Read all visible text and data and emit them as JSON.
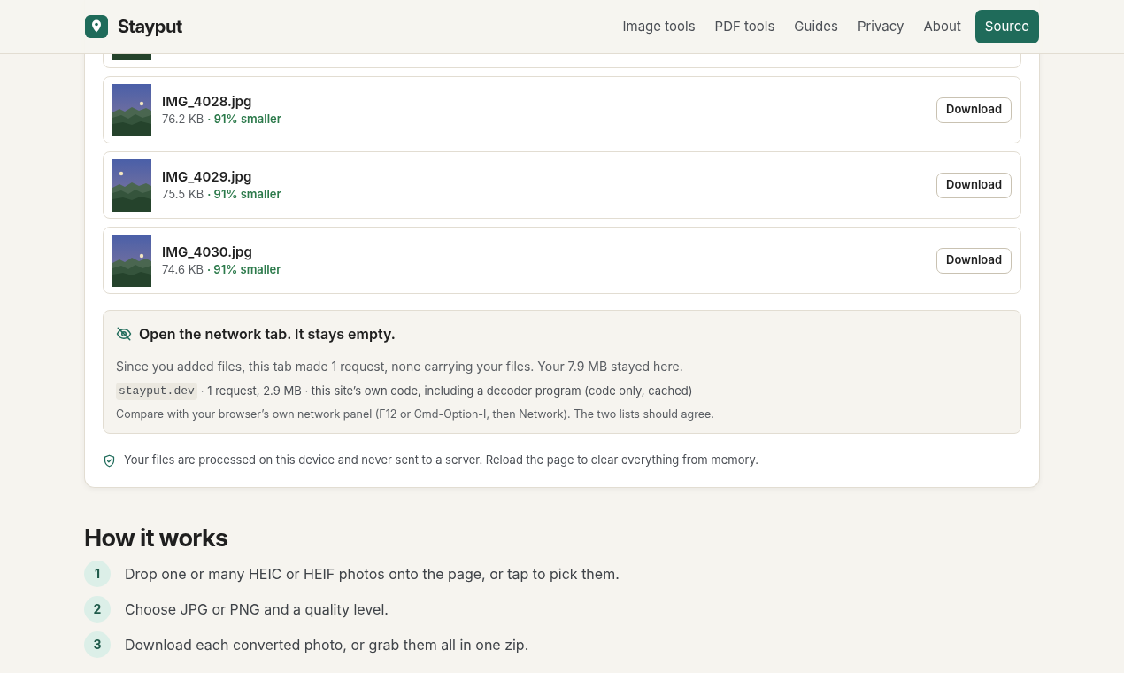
{
  "header": {
    "brand": "Stayput",
    "nav": [
      {
        "label": "Image tools",
        "kind": "link"
      },
      {
        "label": "PDF tools",
        "kind": "link"
      },
      {
        "label": "Guides",
        "kind": "link"
      },
      {
        "label": "Privacy",
        "kind": "link"
      },
      {
        "label": "About",
        "kind": "link"
      },
      {
        "label": "Source",
        "kind": "primary"
      }
    ]
  },
  "files": [
    {
      "name": "IMG_4028.jpg",
      "size": "76.2 KB",
      "saving": "· 91% smaller",
      "button": "Download",
      "kind": "picture"
    },
    {
      "name": "IMG_4029.jpg",
      "size": "75.5 KB",
      "saving": "· 91% smaller",
      "button": "Download",
      "kind": "picture"
    },
    {
      "name": "IMG_4030.jpg",
      "size": "74.6 KB",
      "saving": "· 91% smaller",
      "button": "Download",
      "kind": "picture"
    }
  ],
  "network": {
    "title": "Open the network tab. It stays empty.",
    "summary": "Since you added files, this tab made 1 request, none carrying your files. Your 7.9 MB stayed here.",
    "host": "stayput.dev",
    "detail": "· 1 request, 2.9 MB · this site’s own code, including a decoder program (code only, cached)",
    "note": "Compare with your browser’s own network panel (F12 or Cmd-Option-I, then Network). The two lists should agree."
  },
  "privacy_note": "Your files are processed on this device and never sent to a server. Reload the page to clear everything from memory.",
  "how_it_works": {
    "title": "How it works",
    "steps": [
      {
        "number": "1",
        "text": "Drop one or many HEIC or HEIF photos onto the page, or tap to pick them."
      },
      {
        "number": "2",
        "text": "Choose JPG or PNG and a quality level."
      },
      {
        "number": "3",
        "text": "Download each converted photo, or grab them all in one zip."
      }
    ]
  }
}
